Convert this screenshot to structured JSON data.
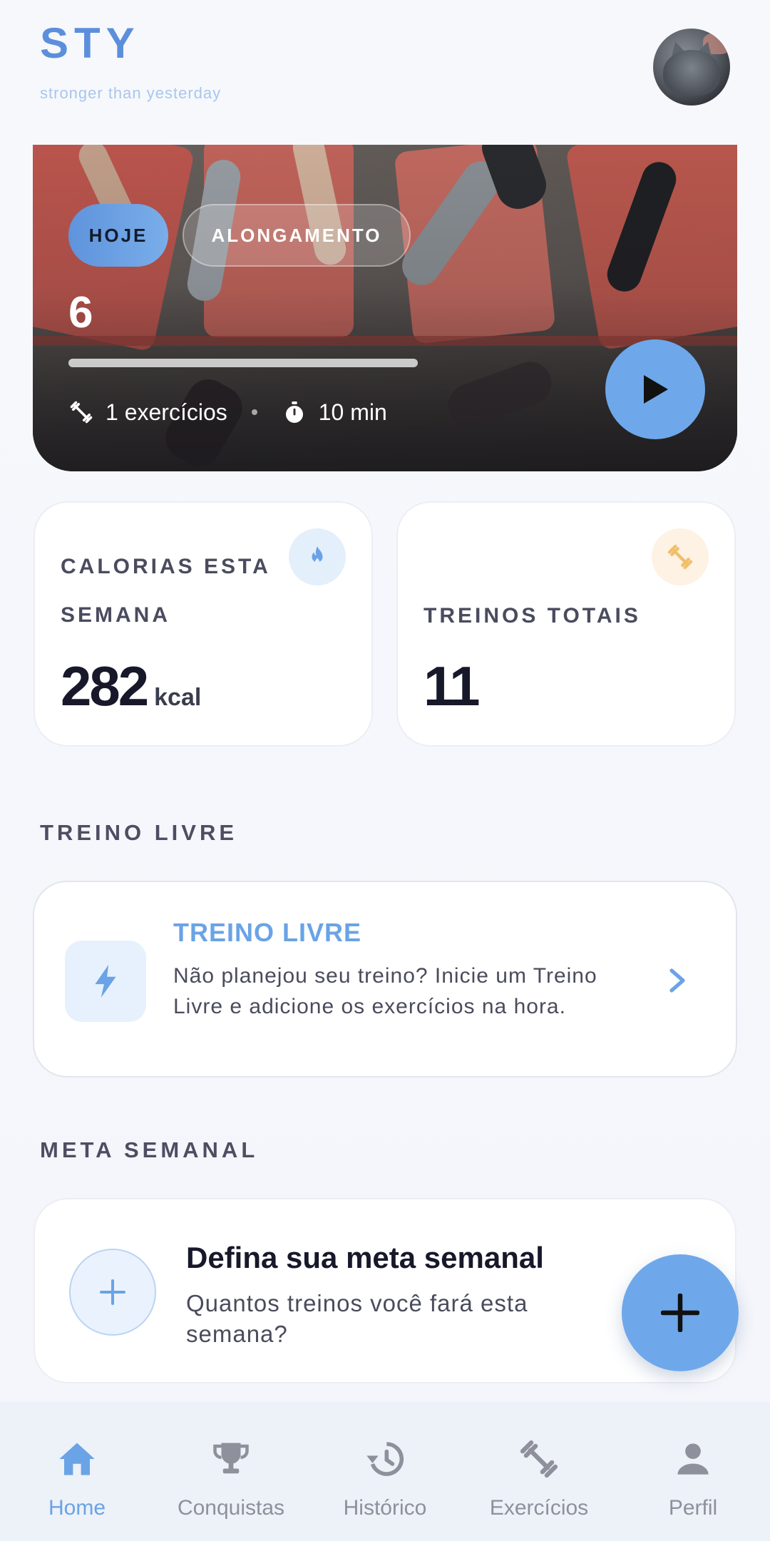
{
  "app": {
    "logo": "STY",
    "tagline": "stronger than yesterday"
  },
  "hero": {
    "today_chip": "HOJE",
    "type_chip": "ALONGAMENTO",
    "count": "6",
    "progress": 1.0,
    "exercises": "1 exercícios",
    "duration": "10 min"
  },
  "stats": {
    "calories": {
      "label": "CALORIAS ESTA SEMANA",
      "value": "282",
      "unit": "kcal"
    },
    "workouts": {
      "label": "TREINOS TOTAIS",
      "value": "11"
    }
  },
  "free_workout": {
    "section_title": "TREINO LIVRE",
    "title": "TREINO LIVRE",
    "description": "Não planejou seu treino? Inicie um Treino Livre e adicione os exercícios na hora."
  },
  "weekly_goal": {
    "section_title": "META SEMANAL",
    "title": "Defina sua meta semanal",
    "subtitle": "Quantos treinos você fará esta semana?"
  },
  "nav": {
    "items": [
      {
        "label": "Home",
        "icon": "home-icon",
        "active": true
      },
      {
        "label": "Conquistas",
        "icon": "trophy-icon",
        "active": false
      },
      {
        "label": "Histórico",
        "icon": "history-icon",
        "active": false
      },
      {
        "label": "Exercícios",
        "icon": "dumbbell-icon",
        "active": false
      },
      {
        "label": "Perfil",
        "icon": "person-icon",
        "active": false
      }
    ]
  },
  "colors": {
    "accent": "#6ea8eb",
    "brand": "#5c8fdb",
    "text_dark": "#17182a",
    "nav_inactive": "#8e909c"
  }
}
